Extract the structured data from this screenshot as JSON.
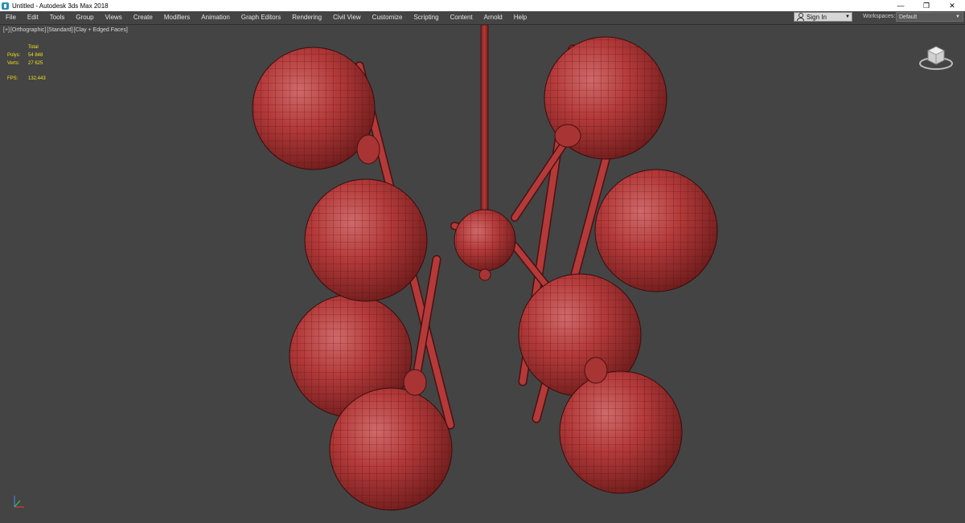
{
  "window": {
    "title": "Untitled - Autodesk 3ds Max 2018",
    "controls": {
      "minimize": "—",
      "restore": "❐",
      "close": "✕"
    }
  },
  "menu": {
    "items": [
      "File",
      "Edit",
      "Tools",
      "Group",
      "Views",
      "Create",
      "Modifiers",
      "Animation",
      "Graph Editors",
      "Rendering",
      "Civil View",
      "Customize",
      "Scripting",
      "Content",
      "Arnold",
      "Help"
    ]
  },
  "account": {
    "sign_in_label": "Sign In"
  },
  "workspaces": {
    "label": "Workspaces:",
    "value": "Default"
  },
  "viewport": {
    "labels": [
      "[+]",
      "[Orthographic]",
      "[Standard]",
      "[Clay + Edged Faces]"
    ],
    "stats": {
      "header": "Total",
      "polys_label": "Polys:",
      "polys_value": "54 848",
      "verts_label": "Verts:",
      "verts_value": "27 625",
      "fps_label": "FPS:",
      "fps_value": "132,443"
    }
  },
  "colors": {
    "viewport_bg": "#444444",
    "mesh_fill": "#b43a3a",
    "mesh_wire": "#4a1010",
    "stats_text": "#f0e020"
  },
  "icons": [
    "app-icon",
    "user-icon",
    "viewcube-icon",
    "axis-tripod-icon"
  ]
}
